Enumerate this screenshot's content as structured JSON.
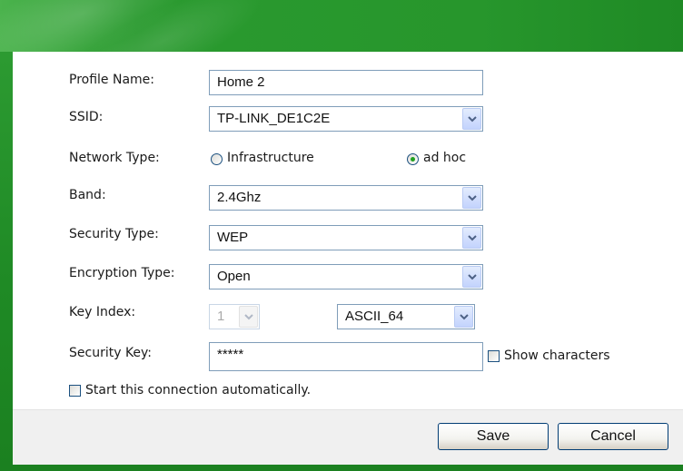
{
  "form": {
    "profile_name": {
      "label": "Profile Name:",
      "value": "Home 2"
    },
    "ssid": {
      "label": "SSID:",
      "value": "TP-LINK_DE1C2E"
    },
    "network_type": {
      "label": "Network Type:",
      "options": [
        {
          "label": "Infrastructure",
          "selected": false
        },
        {
          "label": "ad hoc",
          "selected": true
        }
      ]
    },
    "band": {
      "label": "Band:",
      "value": "2.4Ghz"
    },
    "security_type": {
      "label": "Security Type:",
      "value": "WEP"
    },
    "encryption_type": {
      "label": "Encryption Type:",
      "value": "Open"
    },
    "key_index": {
      "label": "Key Index:",
      "value": "1",
      "disabled": true,
      "format_value": "ASCII_64"
    },
    "security_key": {
      "label": "Security Key:",
      "value": "*****",
      "show_characters_label": "Show characters",
      "show_characters_checked": false
    },
    "auto_connect": {
      "label": "Start this connection automatically.",
      "checked": false
    }
  },
  "buttons": {
    "save": "Save",
    "cancel": "Cancel"
  },
  "colors": {
    "frame_green": "#1f8a25",
    "radio_dot": "#21a121",
    "field_border": "#7f9db9"
  }
}
